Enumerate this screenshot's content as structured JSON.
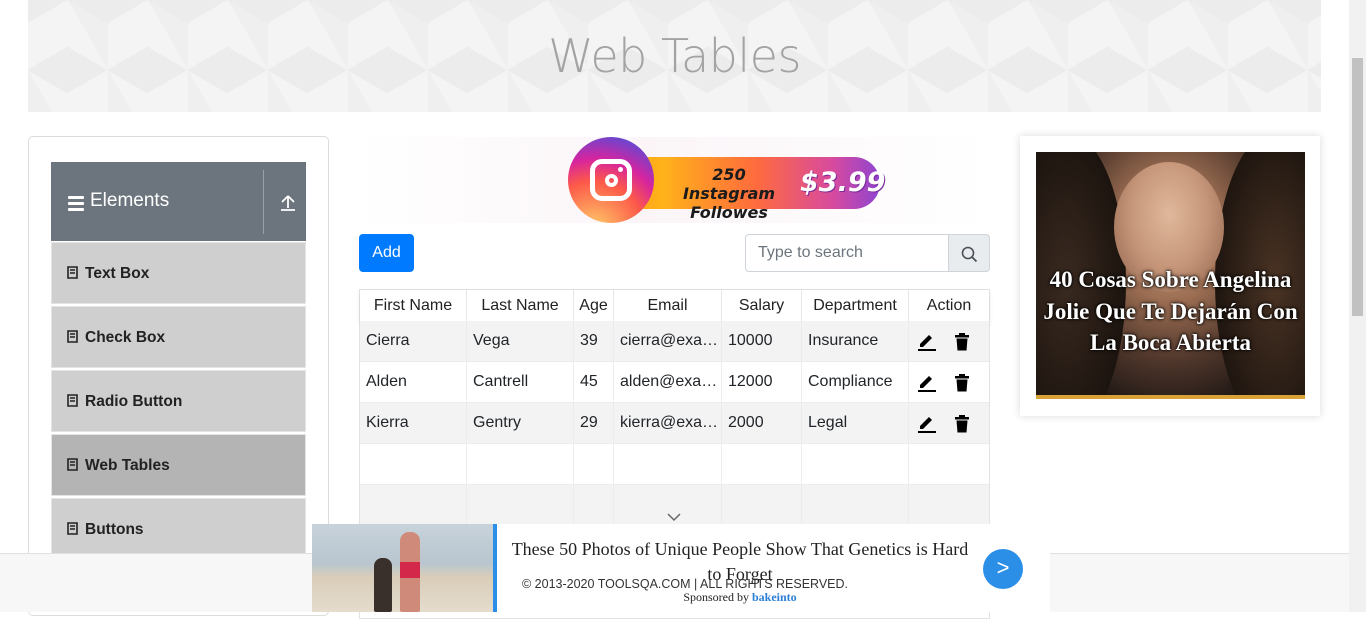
{
  "page": {
    "title": "Web Tables"
  },
  "sidebar": {
    "group_title": "Elements",
    "items": [
      {
        "label": "Text Box",
        "active": false
      },
      {
        "label": "Check Box",
        "active": false
      },
      {
        "label": "Radio Button",
        "active": false
      },
      {
        "label": "Web Tables",
        "active": true
      },
      {
        "label": "Buttons",
        "active": false
      }
    ]
  },
  "ad_top": {
    "text": "250 Instagram Followes",
    "price": "$3.99"
  },
  "toolbar": {
    "add_label": "Add",
    "search_placeholder": "Type to search"
  },
  "table": {
    "headers": [
      "First Name",
      "Last Name",
      "Age",
      "Email",
      "Salary",
      "Department",
      "Action"
    ],
    "rows": [
      [
        "Cierra",
        "Vega",
        "39",
        "cierra@example.com",
        "10000",
        "Insurance"
      ],
      [
        "Alden",
        "Cantrell",
        "45",
        "alden@example.com",
        "12000",
        "Compliance"
      ],
      [
        "Kierra",
        "Gentry",
        "29",
        "kierra@example.com",
        "2000",
        "Legal"
      ]
    ]
  },
  "ad_right": {
    "headline": "40 Cosas Sobre Angelina Jolie Que Te Dejarán Con La Boca Abierta"
  },
  "ad_bottom": {
    "title": "These 50 Photos of Unique People Show That Genetics is Hard to Forget",
    "sponsored_prefix": "Sponsored by",
    "sponsor": "bakeinto",
    "go_label": ">"
  },
  "footer": {
    "text": "© 2013-2020 TOOLSQA.COM | ALL RIGHTS RESERVED."
  },
  "colors": {
    "primary": "#007bff",
    "sidebar_header": "#6c757d",
    "menu_item": "#cfcfcf",
    "menu_item_active": "#b4b4b4"
  }
}
